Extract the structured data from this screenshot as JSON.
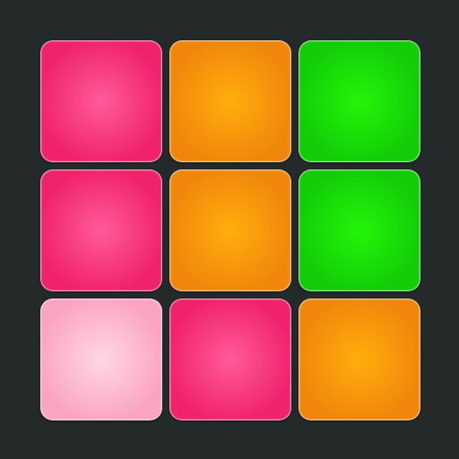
{
  "colors": {
    "background": "#24292a",
    "pink": {
      "center": "#ff5b9a",
      "edge": "#f0226c"
    },
    "orange": {
      "center": "#ffae0d",
      "edge": "#f0860b"
    },
    "green": {
      "center": "#25f409",
      "edge": "#12cc07"
    },
    "light_pink": {
      "center": "#ffd7e4",
      "edge": "#fba4c2"
    }
  },
  "grid": {
    "rows": 3,
    "cols": 3,
    "pads": [
      {
        "row": 0,
        "col": 0,
        "color": "pink"
      },
      {
        "row": 0,
        "col": 1,
        "color": "orange"
      },
      {
        "row": 0,
        "col": 2,
        "color": "green"
      },
      {
        "row": 1,
        "col": 0,
        "color": "pink"
      },
      {
        "row": 1,
        "col": 1,
        "color": "orange"
      },
      {
        "row": 1,
        "col": 2,
        "color": "green"
      },
      {
        "row": 2,
        "col": 0,
        "color": "light_pink",
        "state": "pressed"
      },
      {
        "row": 2,
        "col": 1,
        "color": "pink"
      },
      {
        "row": 2,
        "col": 2,
        "color": "orange"
      }
    ]
  }
}
